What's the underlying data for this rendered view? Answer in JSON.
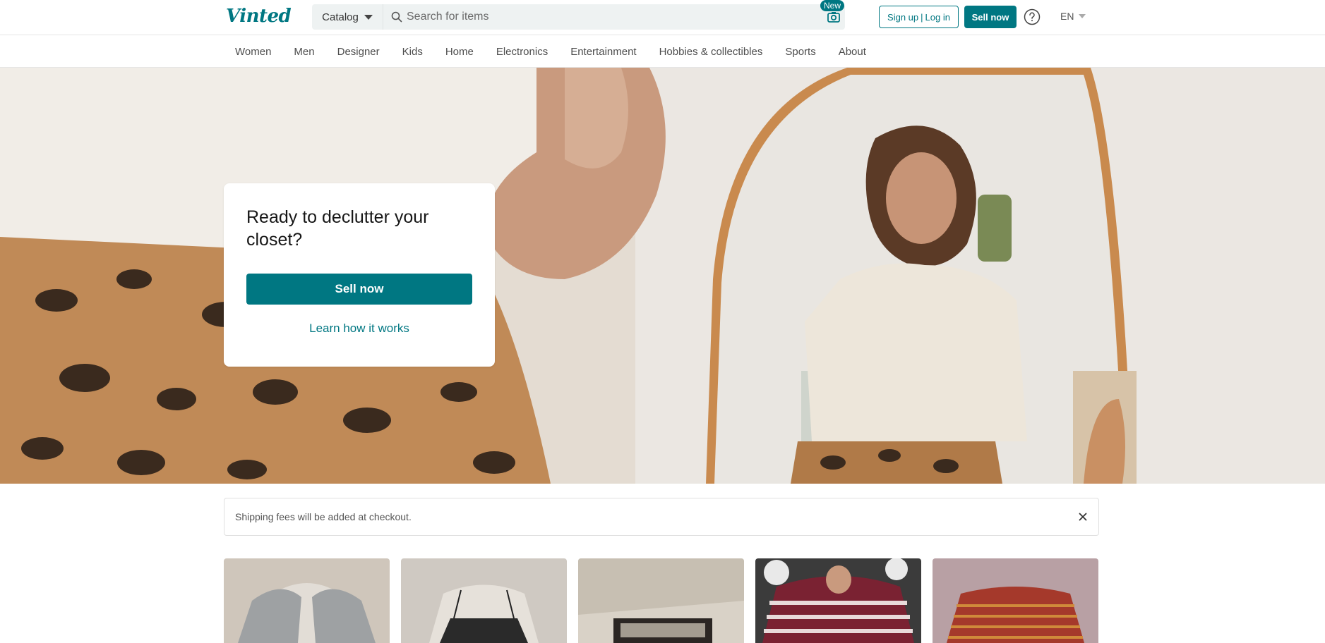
{
  "header": {
    "logo": "Vinted",
    "catalog_label": "Catalog",
    "search_placeholder": "Search for items",
    "new_badge": "New",
    "signup_label": "Sign up",
    "login_label": "Log in",
    "sell_label": "Sell now",
    "language": "EN"
  },
  "nav": {
    "items": [
      "Women",
      "Men",
      "Designer",
      "Kids",
      "Home",
      "Electronics",
      "Entertainment",
      "Hobbies & collectibles",
      "Sports",
      "About"
    ]
  },
  "hero": {
    "title": "Ready to declutter your closet?",
    "sell_label": "Sell now",
    "learn_label": "Learn how it works"
  },
  "notice": {
    "text": "Shipping fees will be added at checkout."
  },
  "colors": {
    "brand": "#007782"
  },
  "items": [
    {
      "name": "grey-hoodie-item"
    },
    {
      "name": "black-cami-item"
    },
    {
      "name": "jewelry-box-item"
    },
    {
      "name": "striped-hoodie-item"
    },
    {
      "name": "red-striped-top-item"
    }
  ]
}
